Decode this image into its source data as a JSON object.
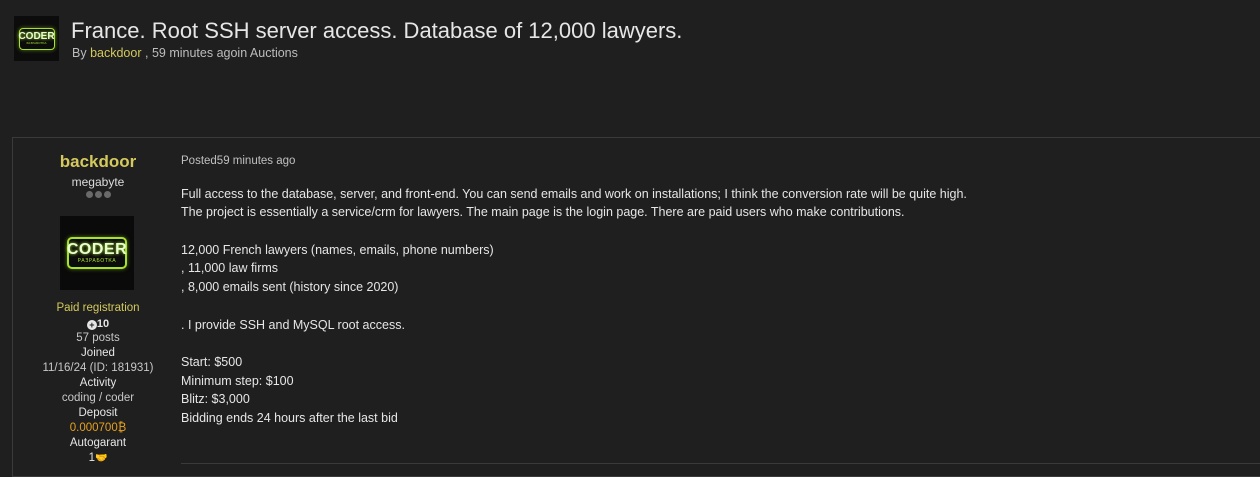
{
  "topic": {
    "logo_text": "CODER",
    "logo_subtext": "РАЗРАБОТКА",
    "title": "France. Root SSH server access. Database of 12,000 lawyers.",
    "meta_by": "By",
    "meta_author": "backdoor",
    "meta_rest": ", 59 minutes agoin Auctions"
  },
  "author": {
    "name": "backdoor",
    "rank": "megabyte",
    "group": "Paid registration",
    "reputation": "10",
    "posts": "57 posts",
    "joined_label": "Joined",
    "joined_value": "11/16/24 (ID: 181931)",
    "activity_label": "Activity",
    "activity_value": "coding / coder",
    "deposit_label": "Deposit",
    "deposit_value": "0.000700",
    "deposit_currency": "₿",
    "autogarant_label": "Autogarant",
    "autogarant_value": "1"
  },
  "post": {
    "posted": "Posted59 minutes ago",
    "lines": [
      "Full access to the database, server, and front-end. You can send emails and work on installations; I think the conversion rate will be quite high.",
      "The project is essentially a service/crm for lawyers. The main page is the login page. There are paid users who make contributions.",
      "12,000 French lawyers (names, emails, phone numbers)",
      ", 11,000 law firms",
      ", 8,000 emails sent (history since 2020)",
      ". I provide SSH and MySQL root access.",
      "Start: $500",
      "Minimum step: $100",
      "Blitz: $3,000",
      "Bidding ends 24 hours after the last bid"
    ]
  },
  "colors": {
    "background": "#1f1f1f",
    "author_accent": "#d4c95c",
    "deposit": "#e6a020",
    "logo_green": "#a6e22e"
  }
}
